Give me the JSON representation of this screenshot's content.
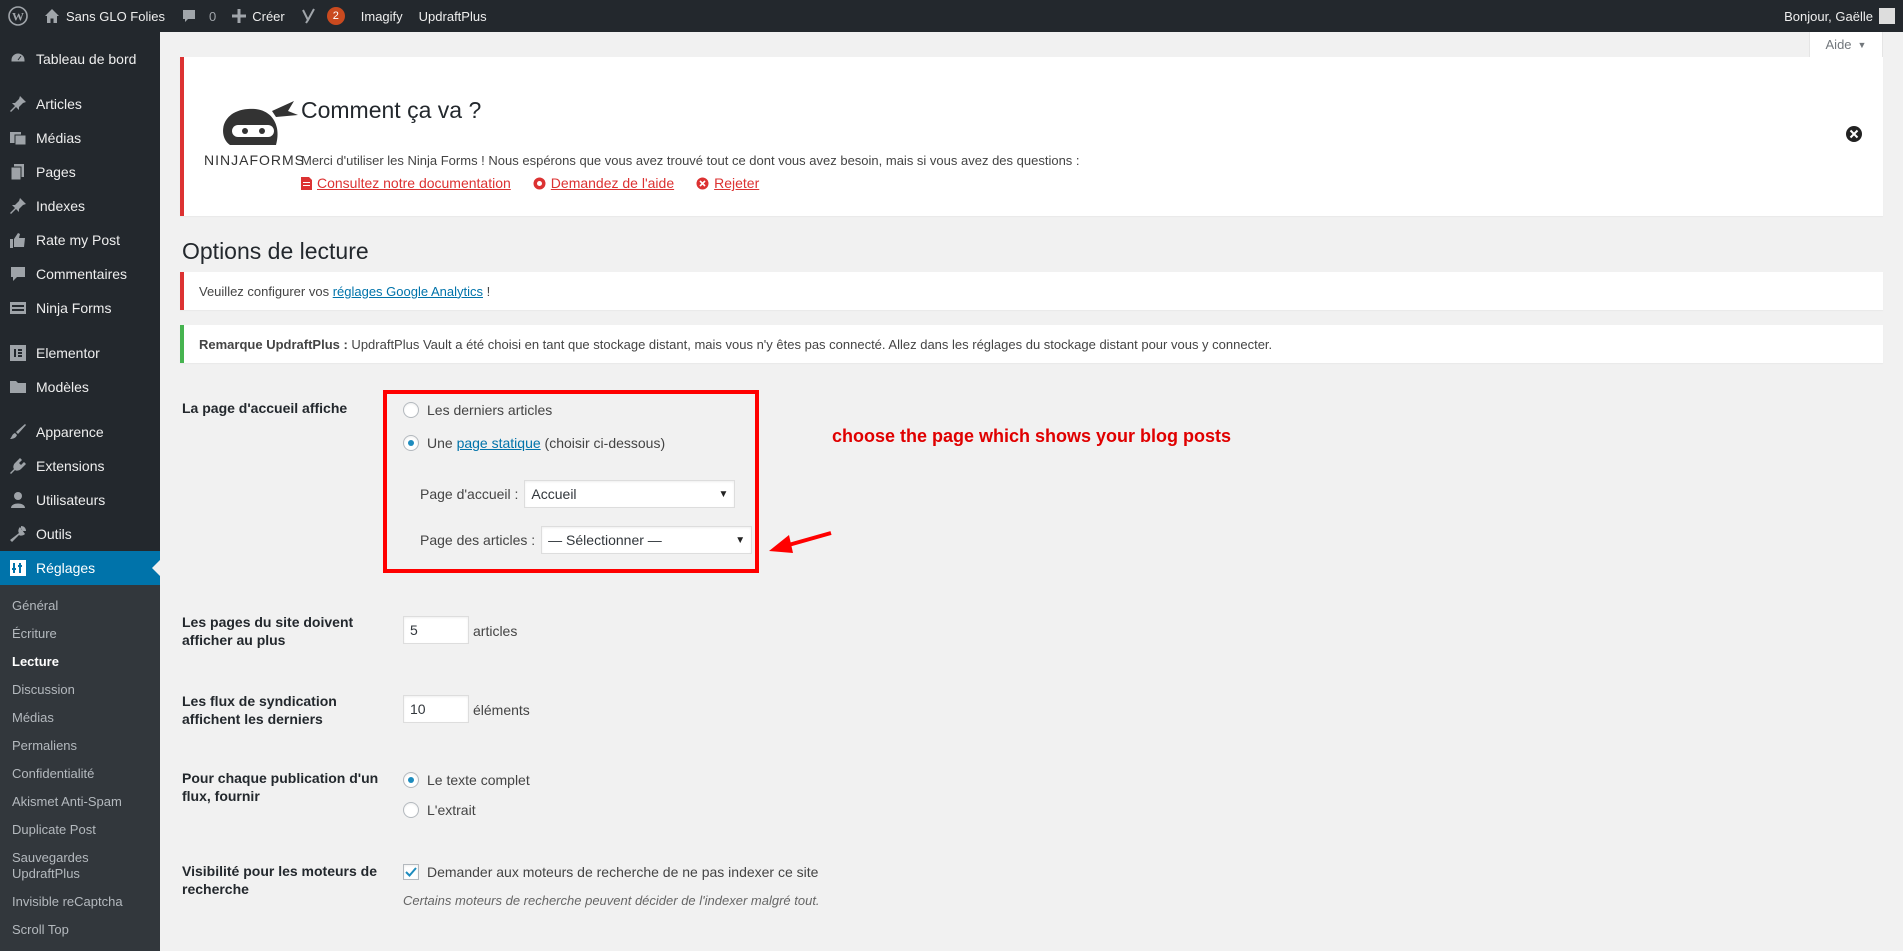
{
  "adminbar": {
    "site_name": "Sans GLO Folies",
    "comments_count": "0",
    "create_label": "Créer",
    "yoast_count": "2",
    "imagify_label": "Imagify",
    "updraft_label": "UpdraftPlus",
    "greeting": "Bonjour, Gaëlle"
  },
  "sidebar": {
    "items": [
      {
        "label": "Tableau de bord",
        "icon": "dashboard-icon"
      },
      {
        "label": "Articles",
        "icon": "pin-icon"
      },
      {
        "label": "Médias",
        "icon": "media-icon"
      },
      {
        "label": "Pages",
        "icon": "pages-icon"
      },
      {
        "label": "Indexes",
        "icon": "pin-icon"
      },
      {
        "label": "Rate my Post",
        "icon": "thumbs-up-icon"
      },
      {
        "label": "Commentaires",
        "icon": "comment-icon"
      },
      {
        "label": "Ninja Forms",
        "icon": "form-icon"
      },
      {
        "label": "Elementor",
        "icon": "elementor-icon"
      },
      {
        "label": "Modèles",
        "icon": "folder-icon"
      },
      {
        "label": "Apparence",
        "icon": "brush-icon"
      },
      {
        "label": "Extensions",
        "icon": "plugin-icon"
      },
      {
        "label": "Utilisateurs",
        "icon": "user-icon"
      },
      {
        "label": "Outils",
        "icon": "wrench-icon"
      },
      {
        "label": "Réglages",
        "icon": "settings-icon"
      }
    ],
    "submenu": [
      "Général",
      "Écriture",
      "Lecture",
      "Discussion",
      "Médias",
      "Permaliens",
      "Confidentialité",
      "Akismet Anti-Spam",
      "Duplicate Post",
      "Sauvegardes UpdraftPlus",
      "Invisible reCaptcha",
      "Scroll Top"
    ]
  },
  "help_tab": "Aide",
  "ninja_notice": {
    "logo_text": "NINJAFORMS",
    "title": "Comment ça va ?",
    "message": "Merci d'utiliser les Ninja Forms ! Nous espérons que vous avez trouvé tout ce dont vous avez besoin, mais si vous avez des questions :",
    "link_docs": "Consultez notre documentation",
    "link_help": "Demandez de l'aide",
    "link_dismiss": "Rejeter"
  },
  "page_title": "Options de lecture",
  "notice_ga": {
    "prefix": "Veuillez configurer vos ",
    "link": "réglages Google Analytics",
    "suffix": " !"
  },
  "notice_updraft": {
    "strong": "Remarque UpdraftPlus :",
    "text": " UpdraftPlus Vault a été choisi en tant que stockage distant, mais vous n'y êtes pas connecté. Allez dans les réglages du stockage distant pour vous y connecter."
  },
  "front_page": {
    "label": "La page d'accueil affiche",
    "option_latest": "Les derniers articles",
    "option_static_prefix": "Une ",
    "option_static_link": "page statique",
    "option_static_suffix": " (choisir ci-dessous)",
    "homepage_label": "Page d'accueil :",
    "homepage_value": "Accueil",
    "posts_page_label": "Page des articles :",
    "posts_page_value": "— Sélectionner —"
  },
  "posts_per_page": {
    "label": "Les pages du site doivent afficher au plus",
    "value": "5",
    "suffix": "articles"
  },
  "feed_items": {
    "label": "Les flux de syndication affichent les derniers",
    "value": "10",
    "suffix": "éléments"
  },
  "feed_content": {
    "label": "Pour chaque publication d'un flux, fournir",
    "option_full": "Le texte complet",
    "option_excerpt": "L'extrait"
  },
  "search_visibility": {
    "label": "Visibilité pour les moteurs de recherche",
    "checkbox_label": "Demander aux moteurs de recherche de ne pas indexer ce site",
    "description": "Certains moteurs de recherche peuvent décider de l'indexer malgré tout."
  },
  "annotation": "choose the page which shows your blog posts",
  "colors": {
    "accent": "#0073aa",
    "sidebar": "#23282d",
    "annotation": "#ff0000"
  }
}
